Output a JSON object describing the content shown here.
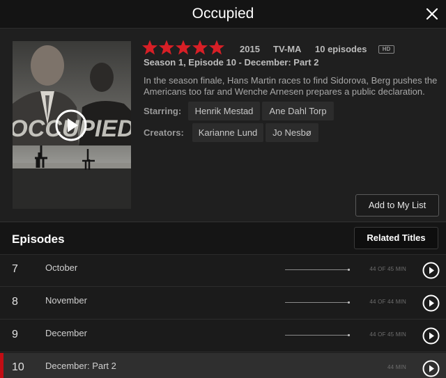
{
  "header": {
    "title": "Occupied",
    "close_icon": "close-icon"
  },
  "show": {
    "rating": 5,
    "year": "2015",
    "maturity": "TV-MA",
    "episodes_count": "10 episodes",
    "quality_badge": "HD",
    "episode_title": "Season 1, Episode 10 - December: Part 2",
    "synopsis": "In the season finale, Hans Martin races to find Sidorova, Berg pushes the Americans too far and Wenche Arnesen prepares a public declaration.",
    "starring_label": "Starring:",
    "starring": [
      "Henrik Mestad",
      "Ane Dahl Torp"
    ],
    "creators_label": "Creators:",
    "creators": [
      "Karianne Lund",
      "Jo Nesbø"
    ],
    "poster_text": "OCCUPIED",
    "star_color": "#d81f26"
  },
  "actions": {
    "add_to_list": "Add to My List",
    "related_titles": "Related Titles"
  },
  "episodes": {
    "heading": "Episodes",
    "items": [
      {
        "number": "7",
        "title": "October",
        "duration": "44 OF 45 MIN",
        "progress": 0.98
      },
      {
        "number": "8",
        "title": "November",
        "duration": "44 OF 44 MIN",
        "progress": 1.0
      },
      {
        "number": "9",
        "title": "December",
        "duration": "44 OF 45 MIN",
        "progress": 0.98
      },
      {
        "number": "10",
        "title": "December: Part 2",
        "duration": "44 MIN",
        "progress": null,
        "active": true
      }
    ]
  },
  "colors": {
    "accent": "#c20d14",
    "background": "#1c1c1c"
  }
}
